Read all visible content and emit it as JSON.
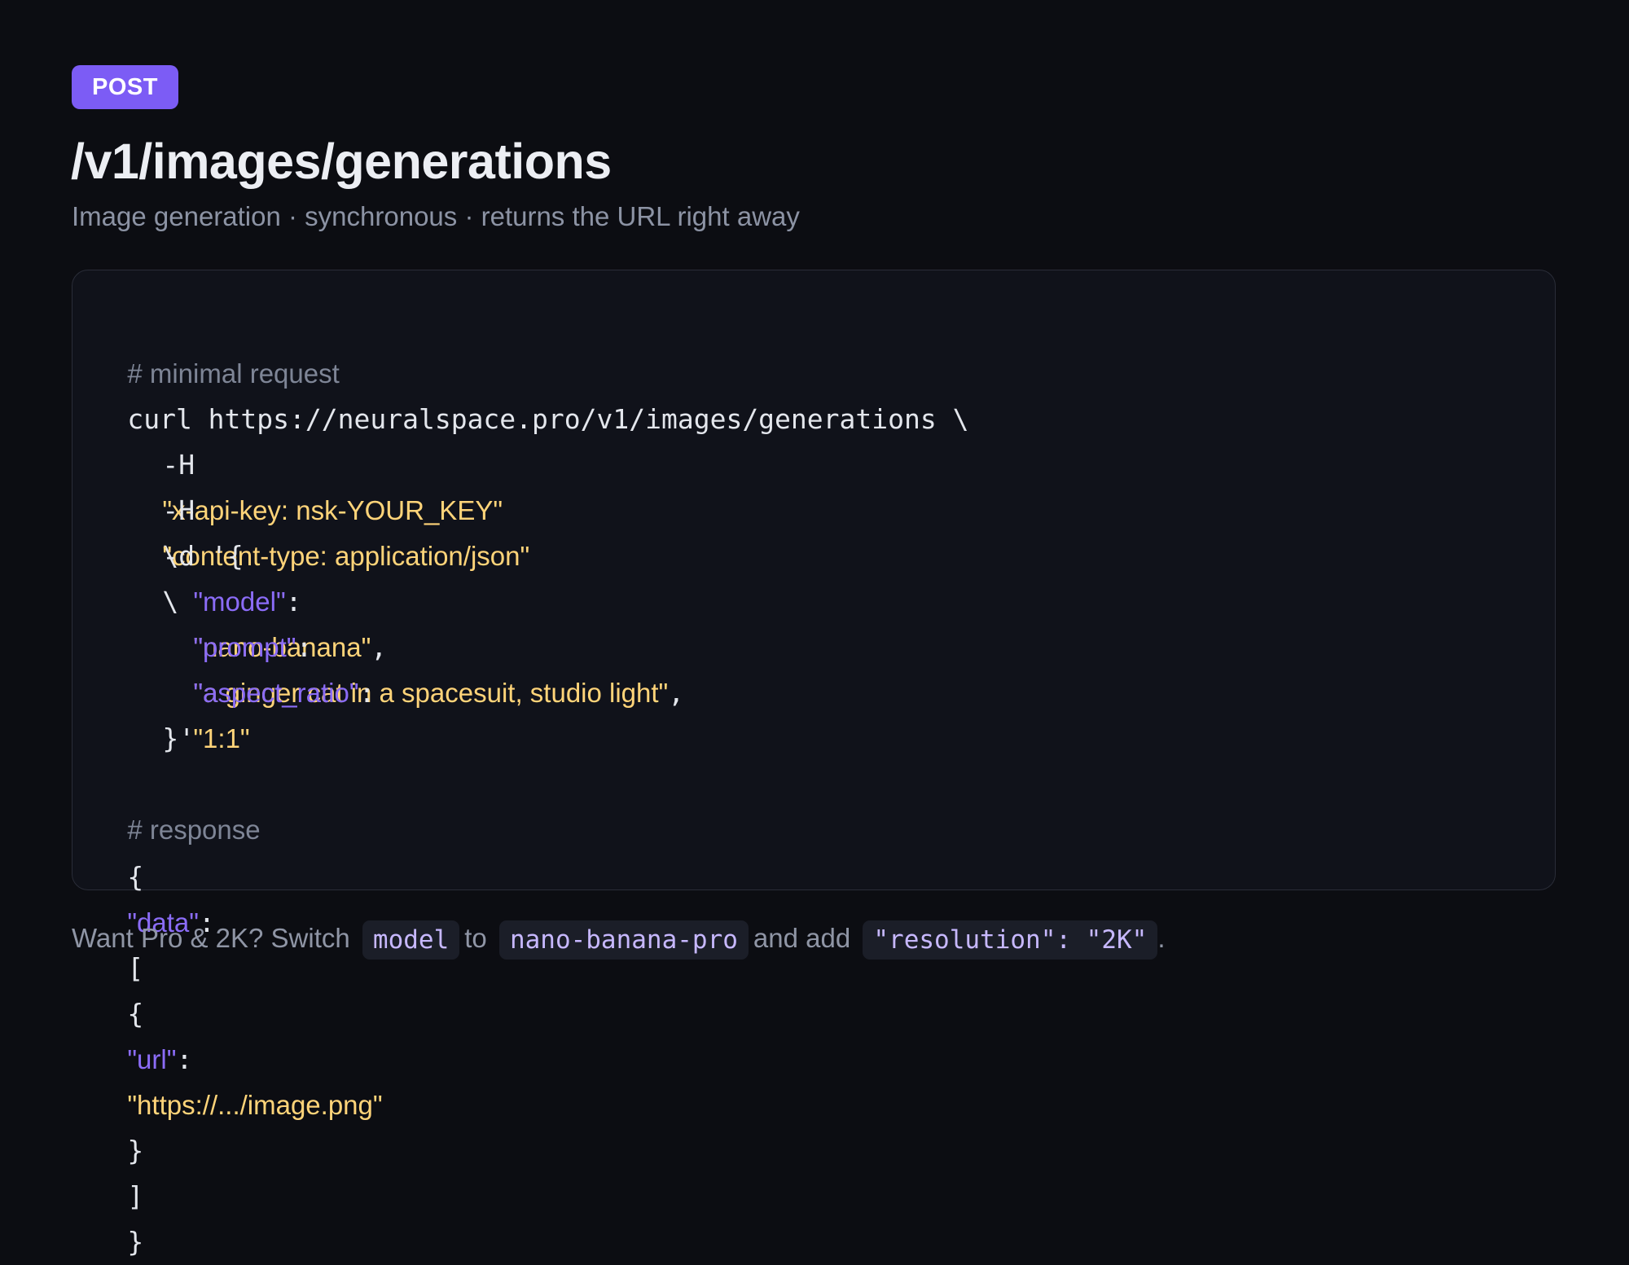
{
  "endpoint": {
    "method": "POST",
    "path": "/v1/images/generations",
    "subtitle": "Image generation · synchronous · returns the URL right away"
  },
  "code_block": {
    "request_comment": "# minimal request",
    "curl_command": "curl https://neuralspace.pro/v1/images/generations \\",
    "header_flag": "-H",
    "header_api_key": "\"x-api-key: nsk-YOUR_KEY\"",
    "header_content_type": "\"content-type: application/json\"",
    "line_continuation": "\\",
    "data_flag_open": "-d '{",
    "body": [
      {
        "key": "\"model\"",
        "value": "\"nano-banana\"",
        "trailing": ","
      },
      {
        "key": "\"prompt\"",
        "value": "\"a ginger cat in a spacesuit, studio light\"",
        "trailing": ","
      },
      {
        "key": "\"aspect_ratio\"",
        "value": "\"1:1\"",
        "trailing": ""
      }
    ],
    "colon": ":",
    "data_close": "}'",
    "response_comment": "# response",
    "response": {
      "open": "{",
      "data_key": "\"data\"",
      "array_open": "[",
      "item_open": "{",
      "url_key": "\"url\"",
      "url_value": "\"https://.../image.png\"",
      "item_close": "}",
      "array_close": "]",
      "close": "}"
    }
  },
  "footer": {
    "text_1": "Want Pro & 2K? Switch",
    "code_1": "model",
    "text_2": "to",
    "code_2": "nano-banana-pro",
    "text_3": "and add",
    "code_3": "\"resolution\": \"2K\"",
    "text_4": "."
  },
  "colors": {
    "background": "#0c0d12",
    "accent": "#7c5cf5",
    "string": "#ffd479",
    "key": "#8b6cf7",
    "comment": "#7e8596"
  }
}
